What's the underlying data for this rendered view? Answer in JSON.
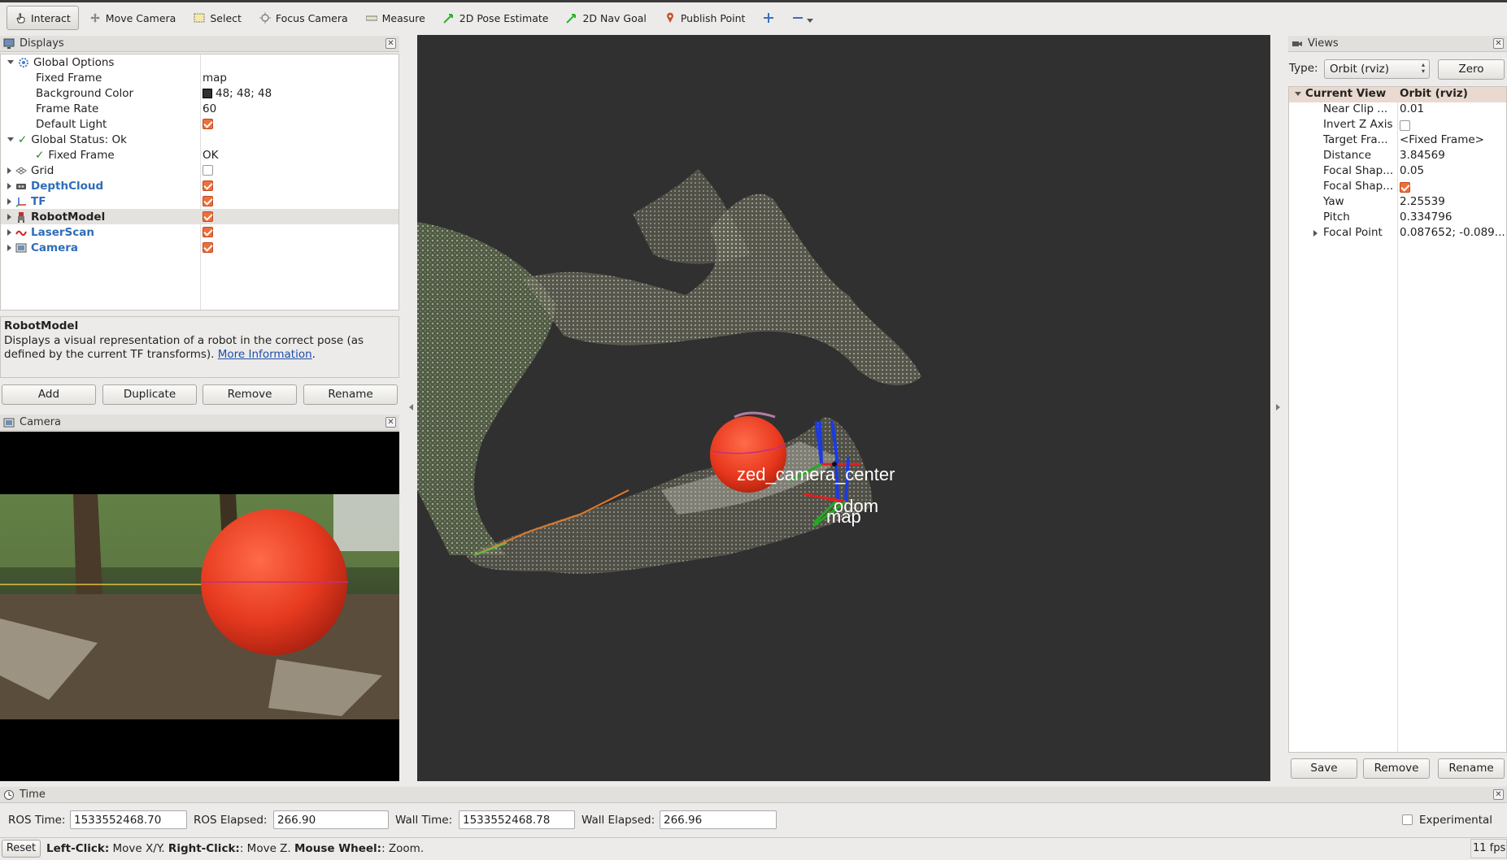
{
  "toolbar": {
    "tools": [
      {
        "label": "Interact",
        "icon": "hand-icon"
      },
      {
        "label": "Move Camera",
        "icon": "move-camera-icon"
      },
      {
        "label": "Select",
        "icon": "select-box-icon"
      },
      {
        "label": "Focus Camera",
        "icon": "focus-camera-icon"
      },
      {
        "label": "Measure",
        "icon": "ruler-icon"
      },
      {
        "label": "2D Pose Estimate",
        "icon": "green-arrow-icon"
      },
      {
        "label": "2D Nav Goal",
        "icon": "green-arrow-icon"
      },
      {
        "label": "Publish Point",
        "icon": "map-pin-icon"
      }
    ]
  },
  "displays": {
    "title": "Displays",
    "rows": [
      {
        "label": "Global Options",
        "value": ""
      },
      {
        "label": "Fixed Frame",
        "value": "map"
      },
      {
        "label": "Background Color",
        "value": "48; 48; 48"
      },
      {
        "label": "Frame Rate",
        "value": "60"
      },
      {
        "label": "Default Light",
        "value": ""
      },
      {
        "label": "Global Status: Ok",
        "value": ""
      },
      {
        "label": "Fixed Frame",
        "value": "OK"
      },
      {
        "label": "Grid",
        "value": ""
      },
      {
        "label": "DepthCloud",
        "value": ""
      },
      {
        "label": "TF",
        "value": ""
      },
      {
        "label": "RobotModel",
        "value": ""
      },
      {
        "label": "LaserScan",
        "value": ""
      },
      {
        "label": "Camera",
        "value": ""
      }
    ],
    "description_title": "RobotModel",
    "description_text": "Displays a visual representation of a robot in the correct pose (as defined by the current TF transforms).",
    "more_info": "More Information",
    "period": ".",
    "buttons": {
      "add": "Add",
      "duplicate": "Duplicate",
      "remove": "Remove",
      "rename": "Rename"
    }
  },
  "camera_panel": {
    "title": "Camera"
  },
  "render": {
    "labels": {
      "zed": "zed_camera_center",
      "odom": "odom",
      "map": "map"
    },
    "background": "#303030"
  },
  "views": {
    "title": "Views",
    "type_label": "Type:",
    "type_value": "Orbit (rviz)",
    "zero": "Zero",
    "header": {
      "name": "Current View",
      "value": "Orbit (rviz)"
    },
    "rows": [
      {
        "label": "Near Clip ...",
        "value": "0.01"
      },
      {
        "label": "Invert Z Axis",
        "value": ""
      },
      {
        "label": "Target Fra...",
        "value": "<Fixed Frame>"
      },
      {
        "label": "Distance",
        "value": "3.84569"
      },
      {
        "label": "Focal Shap...",
        "value": "0.05"
      },
      {
        "label": "Focal Shap...",
        "value": ""
      },
      {
        "label": "Yaw",
        "value": "2.25539"
      },
      {
        "label": "Pitch",
        "value": "0.334796"
      },
      {
        "label": "Focal Point",
        "value": "0.087652; -0.089..."
      }
    ],
    "buttons": {
      "save": "Save",
      "remove": "Remove",
      "rename": "Rename"
    }
  },
  "time": {
    "title": "Time",
    "ros_time_label": "ROS Time:",
    "ros_time": "1533552468.70",
    "ros_elapsed_label": "ROS Elapsed:",
    "ros_elapsed": "266.90",
    "wall_time_label": "Wall Time:",
    "wall_time": "1533552468.78",
    "wall_elapsed_label": "Wall Elapsed:",
    "wall_elapsed": "266.96",
    "experimental": "Experimental"
  },
  "status": {
    "reset": "Reset",
    "left_click": "Left-Click:",
    "left_desc": " Move X/Y. ",
    "right_click": "Right-Click:",
    "right_desc": ": Move Z. ",
    "wheel": "Mouse Wheel:",
    "wheel_desc": ": Zoom.",
    "fps": "11 fps"
  },
  "colors": {
    "accent_check": "#ef6f3a",
    "link_blue": "#2e6db8",
    "ball_red": "#e63a1f"
  }
}
